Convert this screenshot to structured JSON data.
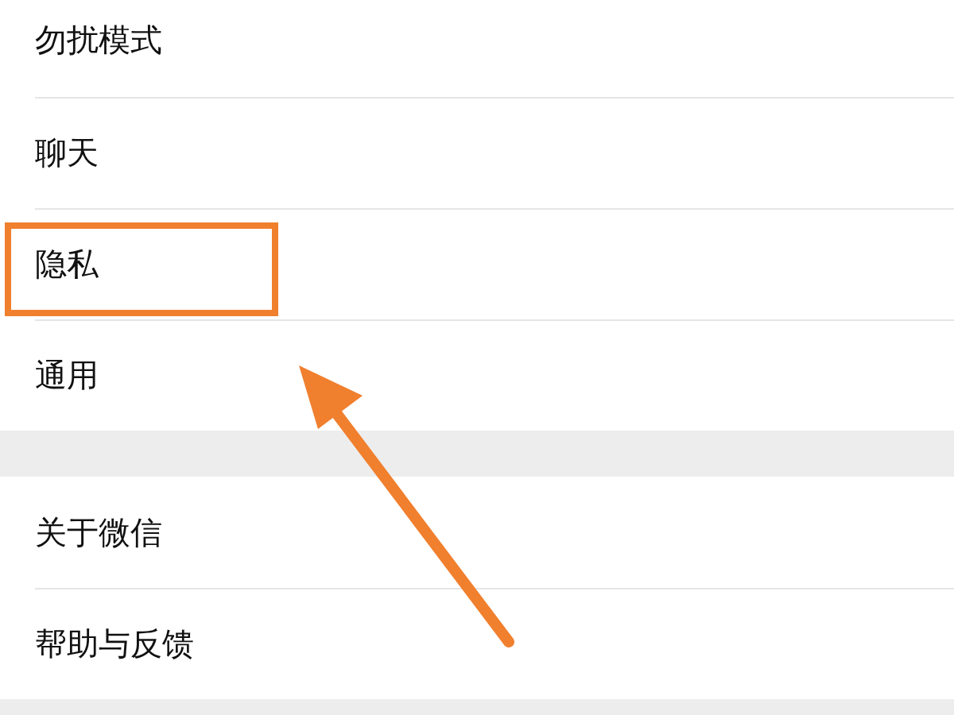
{
  "sections": [
    {
      "items": [
        {
          "label": "勿扰模式",
          "highlighted": false
        },
        {
          "label": "聊天",
          "highlighted": false
        },
        {
          "label": "隐私",
          "highlighted": true
        },
        {
          "label": "通用",
          "highlighted": false
        }
      ]
    },
    {
      "items": [
        {
          "label": "关于微信",
          "highlighted": false
        },
        {
          "label": "帮助与反馈",
          "highlighted": false
        }
      ]
    }
  ]
}
